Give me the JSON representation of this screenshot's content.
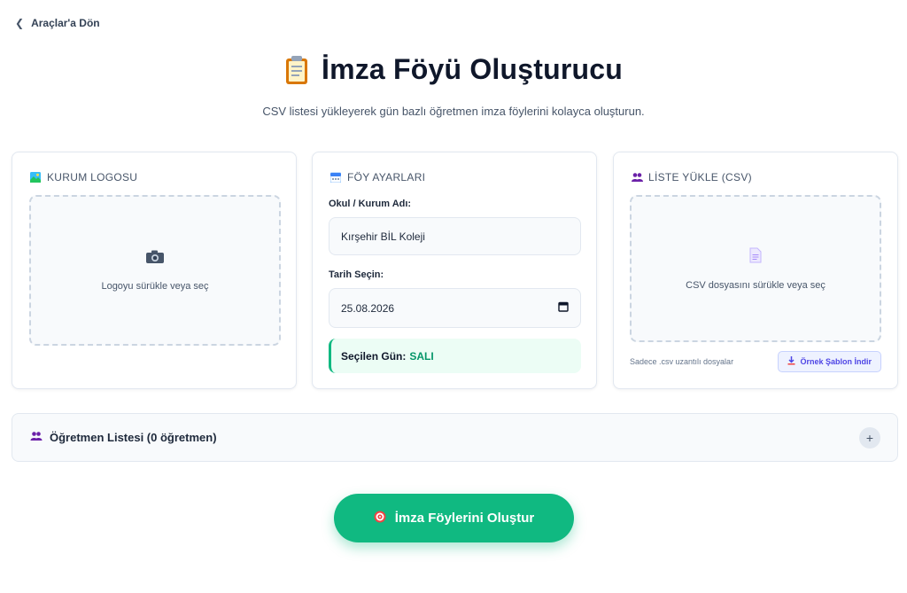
{
  "nav": {
    "back_label": "Araçlar'a Dön"
  },
  "header": {
    "title": "İmza Föyü Oluşturucu",
    "subtitle": "CSV listesi yükleyerek gün bazlı öğretmen imza föylerini kolayca oluşturun."
  },
  "logo_card": {
    "heading": "KURUM LOGOSU",
    "icon": "picture-icon",
    "dropzone_icon": "camera-icon",
    "dropzone_text": "Logoyu sürükle veya seç"
  },
  "settings_card": {
    "heading": "FÖY AYARLARI",
    "icon": "calendar-icon",
    "school_label": "Okul / Kurum Adı:",
    "school_value": "Kırşehir BİL Koleji",
    "date_label": "Tarih Seçin:",
    "date_value": "25.08.2026",
    "selected_day_label": "Seçilen Gün:",
    "selected_day_value": "SALI"
  },
  "csv_card": {
    "heading": "LİSTE YÜKLE (CSV)",
    "icon": "people-icon",
    "dropzone_icon": "document-icon",
    "dropzone_text": "CSV dosyasını sürükle veya seç",
    "note": "Sadece .csv uzantılı dosyalar",
    "template_button": "Örnek Şablon İndir"
  },
  "teacher_list": {
    "title": "Öğretmen Listesi (0 öğretmen)",
    "expand_symbol": "+"
  },
  "action": {
    "create_label": "İmza Föylerini Oluştur"
  },
  "colors": {
    "primary": "#10b981",
    "accent": "#4f46e5",
    "text": "#0f172a"
  }
}
